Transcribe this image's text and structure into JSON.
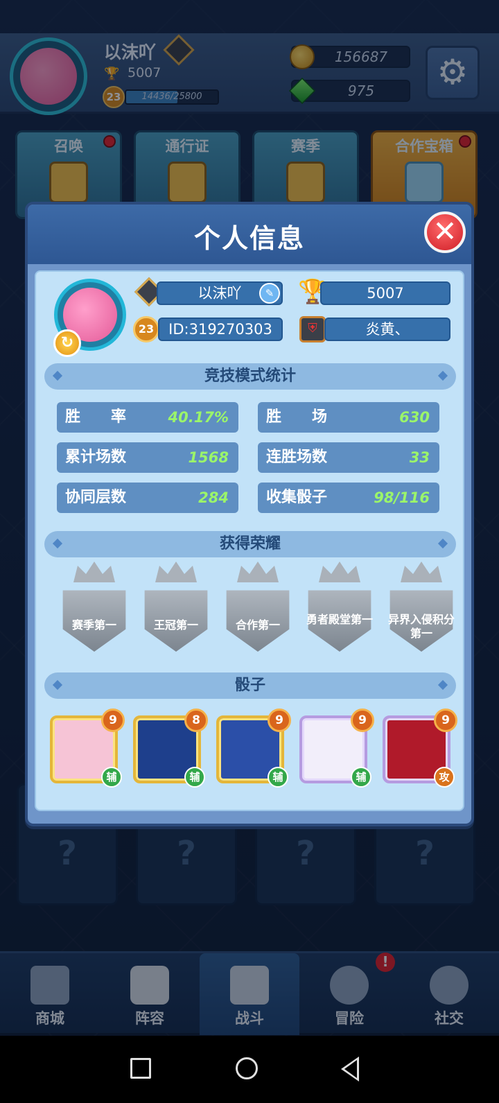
{
  "header": {
    "player_name": "以沫吖",
    "trophies": "5007",
    "level": "23",
    "xp": "14436/25800",
    "xp_fraction": 0.5595,
    "coins": "156687",
    "gems": "975"
  },
  "tiles": [
    {
      "label": "召唤",
      "badge": true
    },
    {
      "label": "通行证",
      "badge": false
    },
    {
      "label": "赛季",
      "badge": false
    },
    {
      "label": "合作宝箱",
      "badge": true
    }
  ],
  "bg_slots": [
    "?",
    "?",
    "?",
    "?"
  ],
  "nav": [
    {
      "label": "商城"
    },
    {
      "label": "阵容"
    },
    {
      "label": "战斗"
    },
    {
      "label": "冒险"
    },
    {
      "label": "社交"
    }
  ],
  "nav_alert": "!",
  "modal": {
    "title": "个人信息",
    "close": "✕",
    "name": "以沫吖",
    "trophies": "5007",
    "level": "23",
    "player_id": "ID:319270303",
    "clan": "炎黄、",
    "stats_title": "竞技模式统计",
    "stats": [
      {
        "label": "胜　　率",
        "value": "40.17%"
      },
      {
        "label": "胜　　场",
        "value": "630"
      },
      {
        "label": "累计场数",
        "value": "1568"
      },
      {
        "label": "连胜场数",
        "value": "33"
      },
      {
        "label": "协同层数",
        "value": "284"
      },
      {
        "label": "收集骰子",
        "value": "98/116"
      }
    ],
    "honors_title": "获得荣耀",
    "honors": [
      "赛季第一",
      "王冠第一",
      "合作第一",
      "勇者殿堂第一",
      "异界入侵积分第一"
    ],
    "dice_title": "骰子",
    "dice": [
      {
        "level": "9",
        "role": "辅",
        "color": "#f6c4d6"
      },
      {
        "level": "8",
        "role": "辅",
        "color": "#1e3f8c"
      },
      {
        "level": "9",
        "role": "辅",
        "color": "#2b4fa8"
      },
      {
        "level": "9",
        "role": "辅",
        "color": "#f2eefa"
      },
      {
        "level": "9",
        "role": "攻",
        "color": "#b01a2a"
      }
    ]
  },
  "colors": {
    "accent_green": "#9bf56a",
    "close_red": "#cf1d26",
    "panel": "#c2e2f8"
  }
}
